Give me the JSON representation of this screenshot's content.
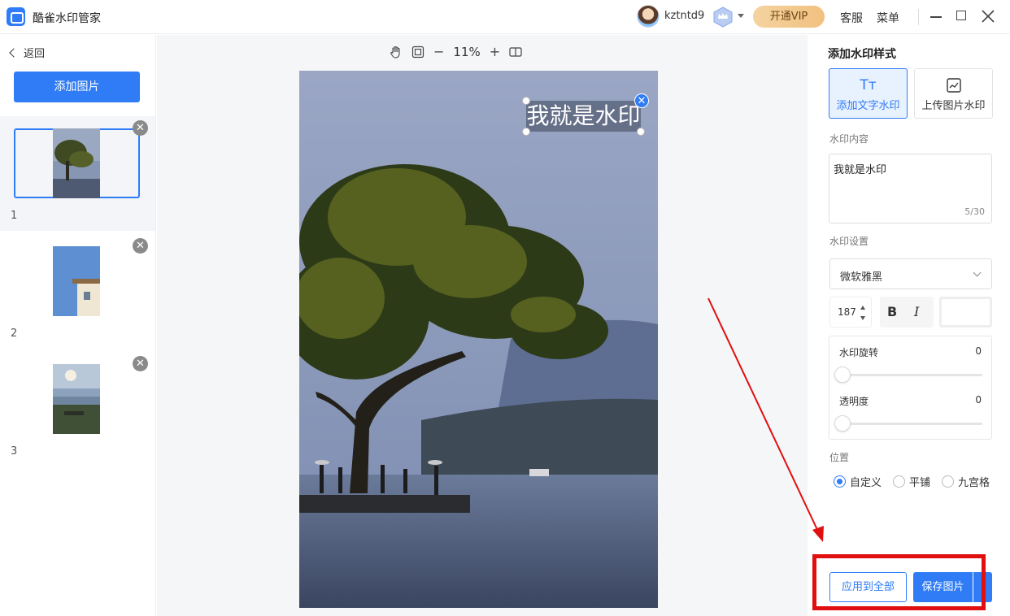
{
  "app": {
    "title": "酷雀水印管家",
    "username": "kztntd9",
    "vip_button": "开通VIP",
    "service_link": "客服",
    "menu_link": "菜单"
  },
  "sidebar": {
    "back_label": "返回",
    "add_image_label": "添加图片",
    "items": [
      {
        "index": "1",
        "active": true
      },
      {
        "index": "2",
        "active": false
      },
      {
        "index": "3",
        "active": false
      }
    ]
  },
  "canvas": {
    "zoom": "11%",
    "zoom_out": "−",
    "zoom_in": "+",
    "watermark_text": "我就是水印"
  },
  "panel": {
    "title": "添加水印样式",
    "modes": {
      "text_label": "添加文字水印",
      "text_icon": "Tт",
      "image_label": "上传图片水印"
    },
    "content_label": "水印内容",
    "content_value": "我就是水印",
    "char_count": "5/30",
    "settings_label": "水印设置",
    "font": "微软雅黑",
    "font_size": "187",
    "bold_label": "B",
    "italic_label": "I",
    "color": "#ffffff",
    "rotation_label": "水印旋转",
    "rotation_value": "0",
    "opacity_label": "透明度",
    "opacity_value": "0",
    "position_label": "位置",
    "position_options": [
      "自定义",
      "平铺",
      "九宫格"
    ],
    "position_selected": "自定义",
    "apply_all_label": "应用到全部",
    "save_label": "保存图片"
  },
  "colors": {
    "accent": "#2f7cf6",
    "annotation": "#e01010",
    "vip_gold": "#f1c07f"
  }
}
